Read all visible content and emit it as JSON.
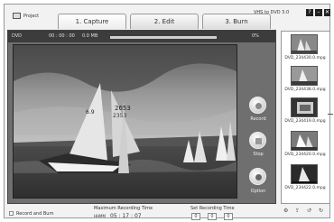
{
  "project_label": "Project",
  "tabs": [
    {
      "label": "1. Capture",
      "active": true
    },
    {
      "label": "2. Edit",
      "active": false
    },
    {
      "label": "3. Burn",
      "active": false
    }
  ],
  "app_title": "VHS to DVD 3.0",
  "window_buttons": {
    "help": "?",
    "minimize": "–",
    "close": "✕"
  },
  "status": {
    "format": "DVD",
    "time": "00 : 00 : 00",
    "size": "0.0 MB",
    "percent": "0%",
    "progress": 1.0
  },
  "controls": {
    "record": "Record",
    "stop": "Stop",
    "option": "Option"
  },
  "files": [
    "DVD_234430.0.mpg",
    "DVD_234438.0.mpg",
    "DVD_234419.0.mpg",
    "DVD_234420.0.mpg",
    "DVD_234422.0.mpg"
  ],
  "bottom": {
    "record_and_burn": "Record and Burn",
    "max_time_label": "Maximum Recording Time",
    "max_time_prefix": "HHMM",
    "max_time_value": "05 : 17 : 07",
    "set_time_label": "Set Recording Time",
    "set_hours": "0",
    "set_minutes": "0",
    "set_seconds": "0"
  },
  "sail_numbers": {
    "a": "6.9",
    "b": "2653",
    "c": "2353"
  },
  "icons": {
    "side_1": "import-icon",
    "side_2": "export-icon",
    "side_3": "rotate-left-icon",
    "side_4": "rotate-right-icon"
  }
}
